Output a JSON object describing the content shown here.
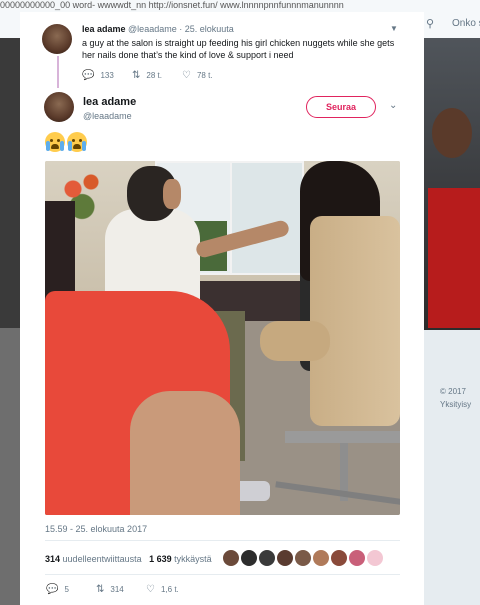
{
  "background": {
    "url_strip": "00000000000_00 word- wwwwdt_nn   http://ionsnet.fun/ www.lnnnnpnnfunnnmanunnnn",
    "search_icon": "search-icon",
    "right_header_text": "Onko s",
    "footer_lines": [
      "© 2017",
      "Yksityisy"
    ]
  },
  "parent_tweet": {
    "name": "lea adame",
    "handle": "@leaadame",
    "date": "· 25. elokuuta",
    "text": "a guy at the salon is straight up feeding his girl chicken nuggets while she gets her nails done that’s the kind of love & support i need",
    "actions": {
      "replies": "133",
      "retweets": "28 t.",
      "likes": "78 t."
    }
  },
  "main_tweet": {
    "name": "lea adame",
    "handle": "@leaadame",
    "follow_label": "Seuraa",
    "emojis": [
      "😭",
      "😭"
    ],
    "timestamp": "15.59 - 25. elokuuta 2017",
    "stats": {
      "retweets_count": "314",
      "retweets_label": "uudelleentwiittausta",
      "likes_count": "1 639",
      "likes_label": "tykkäystä"
    },
    "liker_colors": [
      "#6b4a3a",
      "#2d2d2d",
      "#3a3a3a",
      "#5a3b30",
      "#7a5a48",
      "#b07a5a",
      "#8a4a3a",
      "#c95f79",
      "#f3c7d3"
    ],
    "actions": {
      "replies": "5",
      "retweets": "314",
      "likes": "1,6 t."
    }
  }
}
